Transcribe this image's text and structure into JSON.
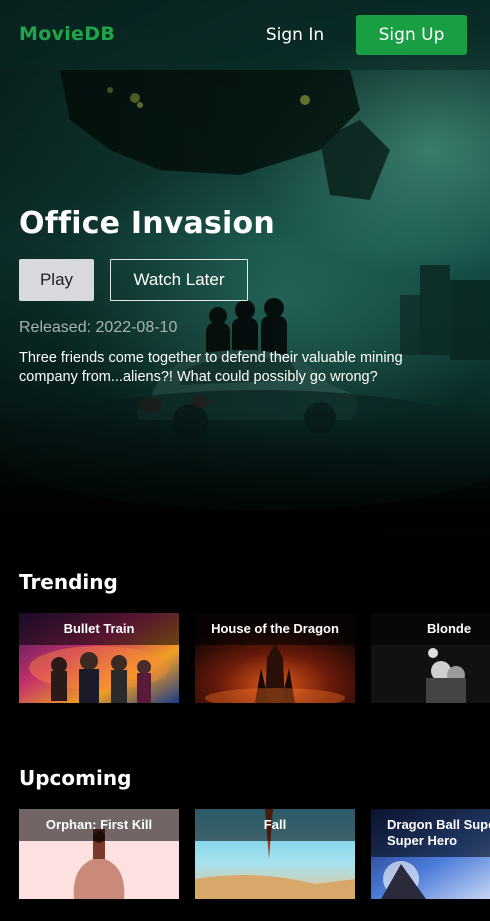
{
  "nav": {
    "logo": "MovieDB",
    "sign_in": "Sign In",
    "sign_up": "Sign Up"
  },
  "hero": {
    "title": "Office Invasion",
    "play_label": "Play",
    "watch_later_label": "Watch Later",
    "released": "Released: 2022-08-10",
    "description": "Three friends come together to defend their valuable mining company from...aliens?! What could possibly go wrong?"
  },
  "trending": {
    "title": "Trending",
    "items": [
      {
        "label": "Bullet Train"
      },
      {
        "label": "House of the Dragon"
      },
      {
        "label": "Blonde"
      }
    ]
  },
  "upcoming": {
    "title": "Upcoming",
    "items": [
      {
        "label": "Orphan: First Kill"
      },
      {
        "label": "Fall"
      },
      {
        "label": "Dragon Ball Super: Super Hero"
      }
    ]
  },
  "colors": {
    "brand": "#1fa64a",
    "sign_up_bg": "#1a9e44",
    "play_bg": "#d8d9de",
    "background": "#000000"
  }
}
